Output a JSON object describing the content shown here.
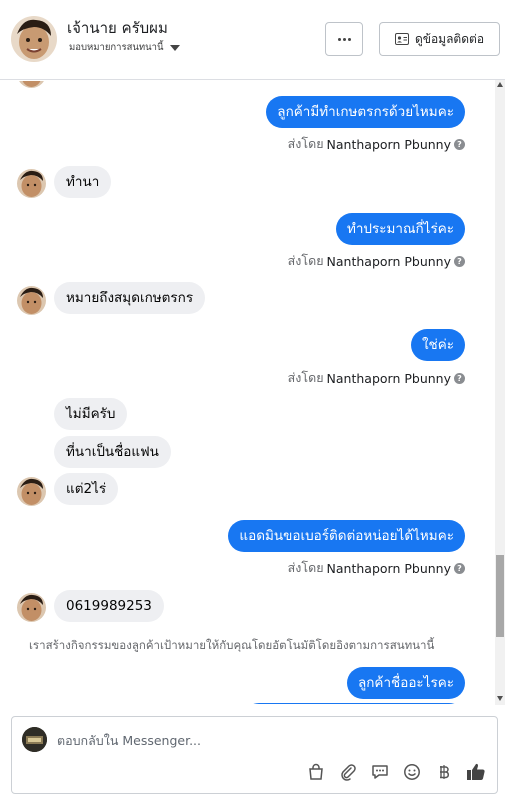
{
  "header": {
    "name": "เจ้านาย ครับผม",
    "assign_label": "มอบหมายการสนทนานี้",
    "contact_button": "ดูข้อมูลติดต่อ"
  },
  "messages": {
    "m1": "ลูกค้ามีทำเกษตรกรด้วยไหมคะ",
    "m2": "ทำนา",
    "m3": "ทำประมาณกี่ไร่คะ",
    "m4": "หมายถึงสมุดเกษตรกร",
    "m5": "ใช่ค่ะ",
    "m6": "ไม่มีครับ",
    "m7": "ที่นาเป็นชื่อแฟน",
    "m8": "แต่2ไร่",
    "m9": "แอดมินขอเบอร์ติดต่อหน่อยได้ไหมคะ",
    "m10": "0619989253",
    "m11": "ลูกค้าชื่ออะไรคะ"
  },
  "sent_by": {
    "prefix": "ส่งโดย",
    "sender": "Nanthaporn Pbunny",
    "info_icon": "?"
  },
  "system_message": "เราสร้างกิจกรรมของลูกค้าเป้าหมายให้กับคุณโดยอัตโนมัติโดยอิงตามการสนทนานี้",
  "composer": {
    "placeholder": "ตอบกลับใน Messenger..."
  },
  "icons": {
    "more": "more-dots-icon",
    "contact": "contact-card-icon",
    "shop": "shopping-bag-icon",
    "attach": "paperclip-icon",
    "saved_reply": "saved-reply-icon",
    "emoji": "emoji-icon",
    "payment": "baht-icon",
    "like": "thumbs-up-icon"
  },
  "colors": {
    "outgoing": "#1877f2",
    "incoming": "#eeeff2",
    "muted": "#65676b"
  }
}
